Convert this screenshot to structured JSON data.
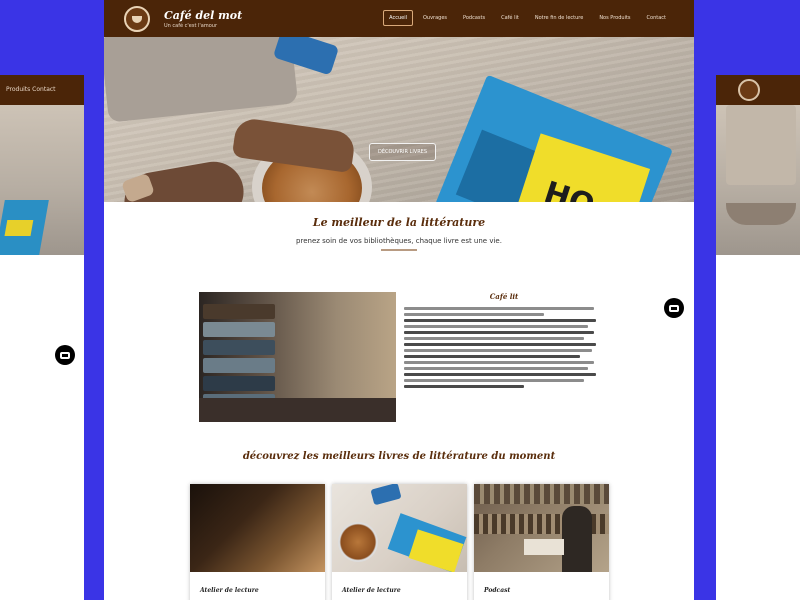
{
  "nav": {
    "brand": "Café del mot",
    "tagline": "Un café c'est l'amour",
    "links": [
      {
        "label": "Accueil",
        "active": true
      },
      {
        "label": "Ouvrages",
        "active": false
      },
      {
        "label": "Podcasts",
        "active": false
      },
      {
        "label": "Café lit",
        "active": false
      },
      {
        "label": "Notre fin de lecture",
        "active": false
      },
      {
        "label": "Nos Produits",
        "active": false
      },
      {
        "label": "Contact",
        "active": false
      }
    ]
  },
  "hero": {
    "button_label": "DÉCOUVRIR LIVRES",
    "book_text": "HO"
  },
  "intro": {
    "title": "Le meilleur de la littérature",
    "subtitle": "prenez soin de vos bibliothèques, chaque livre est une vie."
  },
  "about": {
    "title": "Café lit"
  },
  "discover": {
    "title": "découvrez les meilleurs livres de littérature du moment"
  },
  "cards": [
    {
      "title": "Atelier de lecture"
    },
    {
      "title": "Atelier de lecture"
    },
    {
      "title": "Podcast"
    }
  ],
  "ghost_left": {
    "nav_text": "Produits    Contact"
  },
  "colors": {
    "nav_bg": "#4b2508",
    "accent": "#5a2d0c",
    "page_bg": "#3a34e6"
  }
}
